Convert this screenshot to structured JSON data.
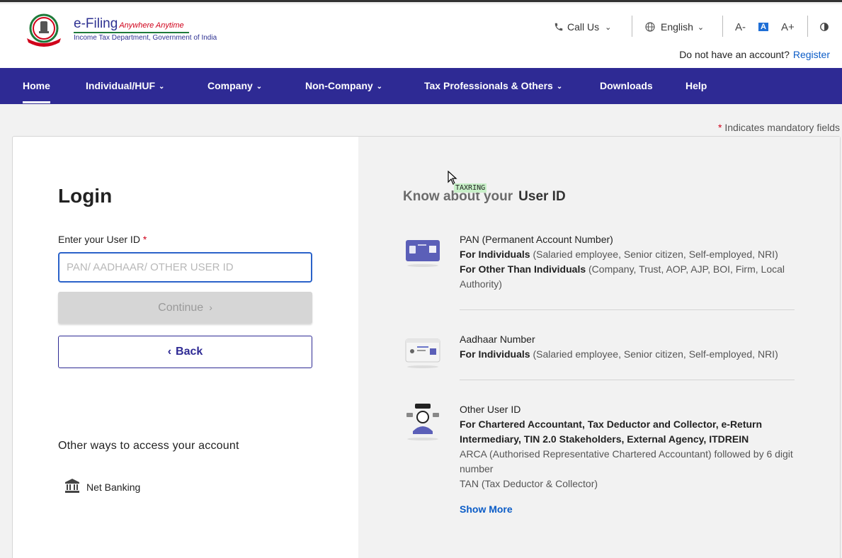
{
  "header": {
    "logo_title": "e-Filing",
    "logo_tagline": "Anywhere Anytime",
    "logo_subtitle": "Income Tax Department, Government of India",
    "call_us": "Call Us",
    "language": "English",
    "font_decrease": "A-",
    "font_normal": "A",
    "font_increase": "A+",
    "no_account": "Do not have an account?",
    "register": "Register"
  },
  "nav": {
    "items": [
      {
        "label": "Home",
        "dropdown": false
      },
      {
        "label": "Individual/HUF",
        "dropdown": true
      },
      {
        "label": "Company",
        "dropdown": true
      },
      {
        "label": "Non-Company",
        "dropdown": true
      },
      {
        "label": "Tax Professionals & Others",
        "dropdown": true
      },
      {
        "label": "Downloads",
        "dropdown": false
      },
      {
        "label": "Help",
        "dropdown": false
      }
    ]
  },
  "mandatory_note": "Indicates mandatory fields",
  "login": {
    "title": "Login",
    "userid_label": "Enter your User ID",
    "userid_placeholder": "PAN/ AADHAAR/ OTHER USER ID",
    "userid_value": "",
    "continue": "Continue",
    "back": "Back",
    "other_ways": "Other ways to access your account",
    "net_banking": "Net Banking"
  },
  "cursor_tooltip": "TAXRING",
  "know": {
    "prefix": "Know about your",
    "highlight": "User ID",
    "items": [
      {
        "title": "PAN (Permanent Account Number)",
        "lines": [
          {
            "bold": "For Individuals",
            "rest": " (Salaried employee, Senior citizen, Self-employed, NRI)"
          },
          {
            "bold": "For Other Than Individuals",
            "rest": " (Company, Trust, AOP, AJP, BOI, Firm, Local Authority)"
          }
        ]
      },
      {
        "title": "Aadhaar Number",
        "lines": [
          {
            "bold": "For Individuals",
            "rest": " (Salaried employee, Senior citizen, Self-employed, NRI)"
          }
        ]
      },
      {
        "title": "Other User ID",
        "bold_block": "For Chartered Accountant, Tax Deductor and Collector, e-Return Intermediary, TIN 2.0 Stakeholders, External Agency, ITDREIN",
        "lines_plain": [
          "ARCA (Authorised Representative Chartered Accountant) followed by 6 digit number",
          "TAN (Tax Deductor & Collector)"
        ]
      }
    ],
    "show_more": "Show More"
  }
}
